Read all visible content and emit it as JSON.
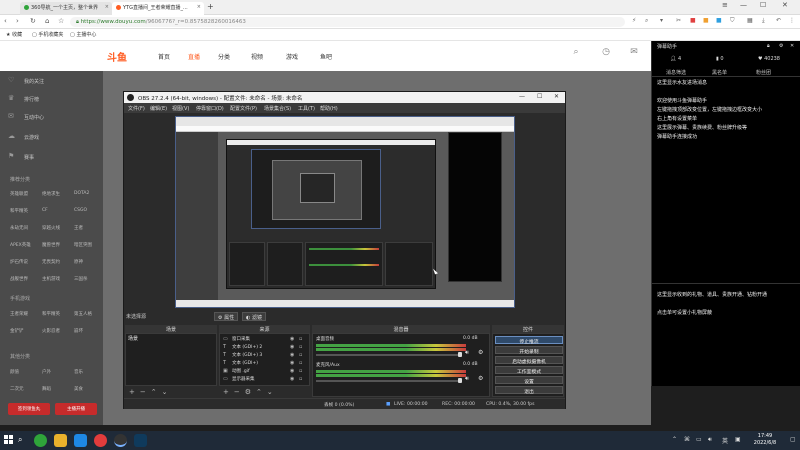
{
  "browser": {
    "tabs": [
      {
        "title": "360导航_一个主页，整个世界"
      },
      {
        "title": "YTG直播间_王者荣耀直播_..."
      }
    ],
    "url_host": "https://www.douyu.com",
    "url_path": "/9606776?_r=0.8575828260016463",
    "bookmarks": [
      "收藏",
      "手机收藏夹",
      "主播中心"
    ]
  },
  "site": {
    "logo": "斗鱼",
    "nav": [
      "首页",
      "直播",
      "分类",
      "视频",
      "游戏",
      "鱼吧"
    ],
    "download_label": "下载",
    "sidebar": {
      "items": [
        "我的关注",
        "排行榜",
        "互动中心",
        "云游戏",
        "赛事"
      ],
      "section_recommend": "推荐分类",
      "grid": [
        [
          "英雄联盟",
          "绝地求生",
          "DOTA2"
        ],
        [
          "和平精英",
          "CF",
          "CSGO"
        ],
        [
          "永劫无间",
          "穿越火线",
          "王者"
        ],
        [
          "APEX英雄",
          "魔兽世界",
          "暗区突围"
        ],
        [
          "炉石传说",
          "无畏契约",
          "原神"
        ],
        [
          "战舰世界",
          "主机游戏",
          "三国杀"
        ]
      ],
      "section_hot": "手机游戏",
      "grid2": [
        [
          "王者荣耀",
          "和平精英",
          "第五人格"
        ],
        [
          "金铲铲",
          "火影忍者",
          "崩坏"
        ]
      ],
      "section_more": "其他分类",
      "grid3": [
        [
          "颜值",
          "户外",
          "音乐"
        ],
        [
          "二次元",
          "舞蹈",
          "美食"
        ]
      ],
      "btn_left": "签到领鱼丸",
      "btn_right": "主播开播"
    }
  },
  "obs": {
    "title": "OBS 27.2.4 (64-bit, windows) - 配置文件: 未命名 - 场景: 未命名",
    "menu": [
      "文件(F)",
      "编辑(E)",
      "视图(V)",
      "停靠窗口(D)",
      "配置文件(P)",
      "场景集合(S)",
      "工具(T)",
      "帮助(H)"
    ],
    "no_source": "未选择源",
    "props_btn": "属性",
    "filters_btn": "滤镜",
    "docks": {
      "scenes": "场景",
      "sources": "来源",
      "mixer": "混音器",
      "controls": "控件"
    },
    "scene_name": "场景",
    "sources": [
      {
        "icon": "monitor-icon",
        "label": "窗口采集"
      },
      {
        "icon": "text-icon",
        "label": "文本 (GDI+) 2"
      },
      {
        "icon": "text-icon",
        "label": "文本 (GDI+) 3"
      },
      {
        "icon": "text-icon",
        "label": "文本 (GDI+)"
      },
      {
        "icon": "gif-icon",
        "label": "动图 .gif"
      },
      {
        "icon": "monitor-icon",
        "label": "显示器采集"
      }
    ],
    "mixer": [
      {
        "name": "桌面音频",
        "value": "0.0 dB"
      },
      {
        "name": "麦克风/Aux",
        "value": "0.0 dB"
      }
    ],
    "controls": [
      "停止推流",
      "开始录制",
      "启动虚拟摄像机",
      "工作室模式",
      "设置",
      "退出"
    ],
    "status": {
      "drop": "丢帧 0 (0.0%)",
      "live": "LIVE: 00:00:00",
      "rec": "REC: 00:00:00",
      "cpu": "CPU: 0.4%, 30.00 fps"
    }
  },
  "chat": {
    "title": "弹幕助手",
    "viewers": "4",
    "gifts": "0",
    "likes": "40238",
    "tabs": [
      "消息筛选",
      "黑名单",
      "粉丝团"
    ],
    "lines_top": [
      "这里显示水友进场消息",
      "",
      "欢迎使用斗鱼弹幕助手",
      "左键拖拽顶部改变位置，左键拖拽边框改变大小",
      "右上角有设置菜单",
      "这里展示弹幕、贵族续费、粉丝牌升级等",
      "弹幕助手连接成功"
    ],
    "lines_bottom": [
      "这里显示收到的礼物、道具、贵族开通、钻粉开通",
      "",
      "点击单可设置小礼物屏蔽"
    ]
  },
  "taskbar": {
    "time": "17:49",
    "date": "2022/6/8"
  }
}
